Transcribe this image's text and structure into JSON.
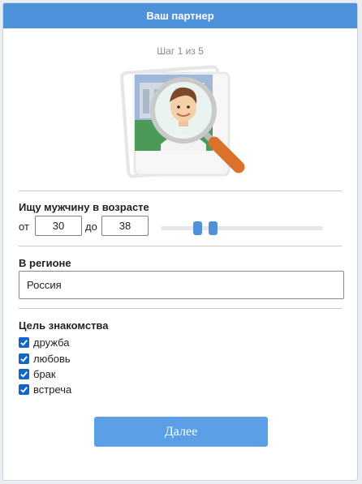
{
  "header": {
    "title": "Ваш партнер"
  },
  "step": {
    "text": "Шаг 1 из 5"
  },
  "illustration": {
    "icon": "partner-search-magnifier-icon"
  },
  "age": {
    "label": "Ищу мужчину в возрасте",
    "from_label": "от",
    "from_value": "30",
    "to_label": "до",
    "to_value": "38",
    "slider_min_value": 30,
    "slider_max_value": 38
  },
  "region": {
    "label": "В регионе",
    "value": "Россия"
  },
  "goal": {
    "label": "Цель знакомства",
    "options": [
      {
        "label": "дружба",
        "checked": true
      },
      {
        "label": "любовь",
        "checked": true
      },
      {
        "label": "брак",
        "checked": true
      },
      {
        "label": "встреча",
        "checked": true
      }
    ]
  },
  "actions": {
    "next_label": "Далее"
  },
  "colors": {
    "header": "#4e92dc",
    "button": "#5ba0e6",
    "checkbox": "#0f68c9"
  }
}
